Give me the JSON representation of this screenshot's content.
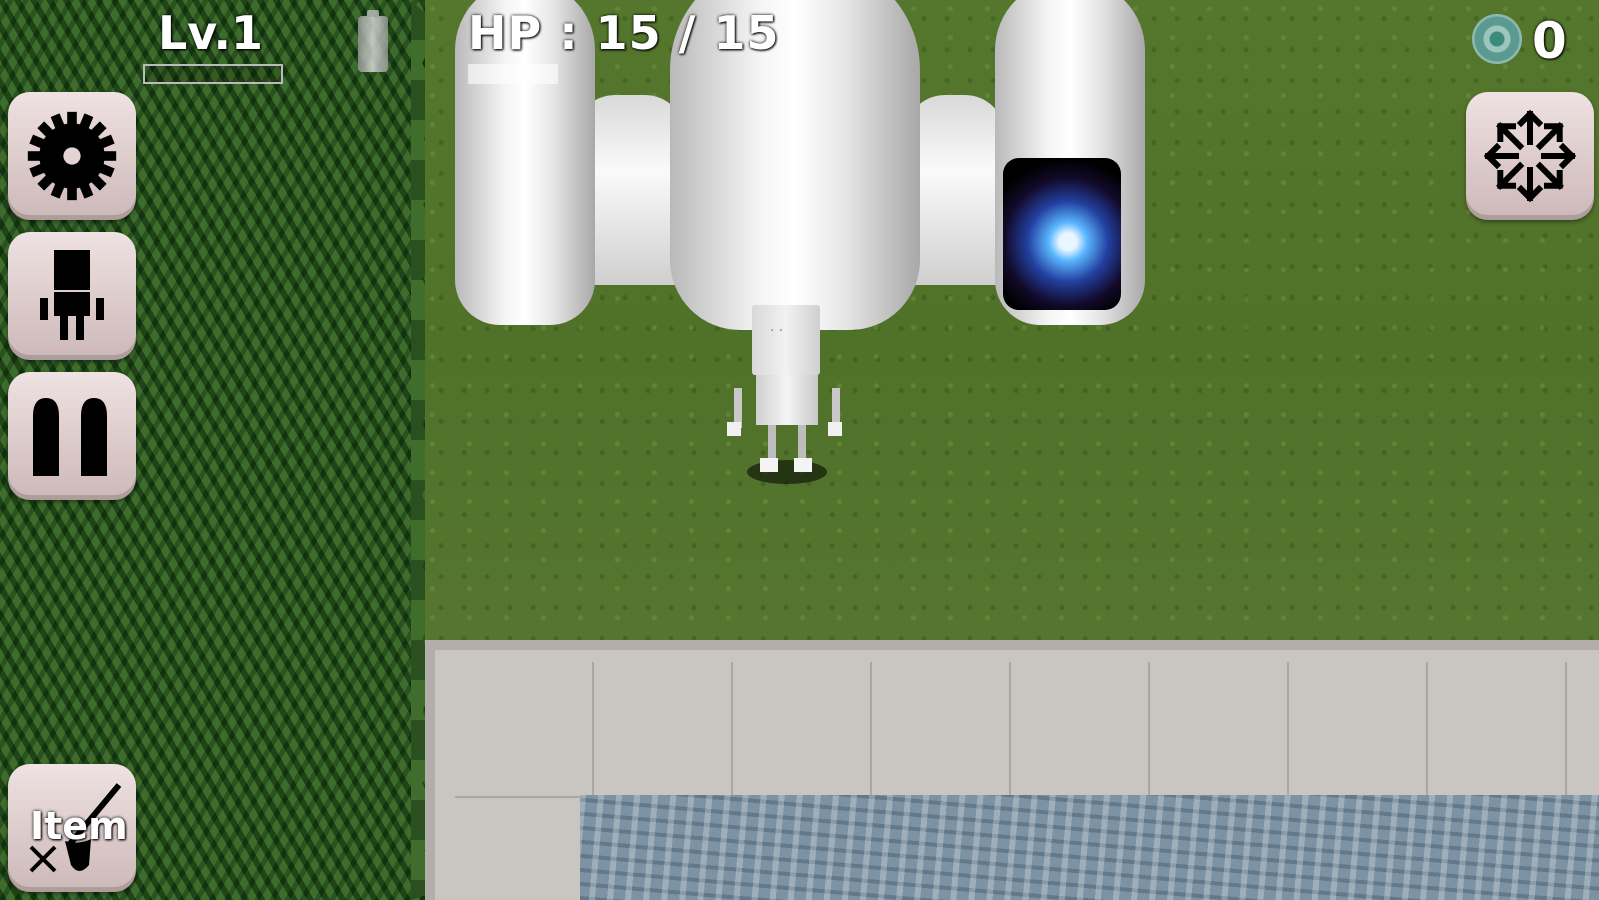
{
  "hud": {
    "level_label": "Lv.1",
    "xp_fraction": 0.0,
    "hp_label": "HP : 15 / 15",
    "hp_fraction": 1.0,
    "coin_count": "0"
  },
  "buttons": {
    "settings_icon": "gear-icon",
    "character_icon": "robot-silhouette-icon",
    "pause_icon": "pause-icon",
    "item_label": "Item",
    "item_icon": "sword-shield-icon",
    "directions_icon": "eight-direction-arrows-icon"
  },
  "colors": {
    "hud_text": "#ffffff",
    "button_bg": "#e6d6d6",
    "grass": "#52742b",
    "forest": "#2f5a22"
  }
}
